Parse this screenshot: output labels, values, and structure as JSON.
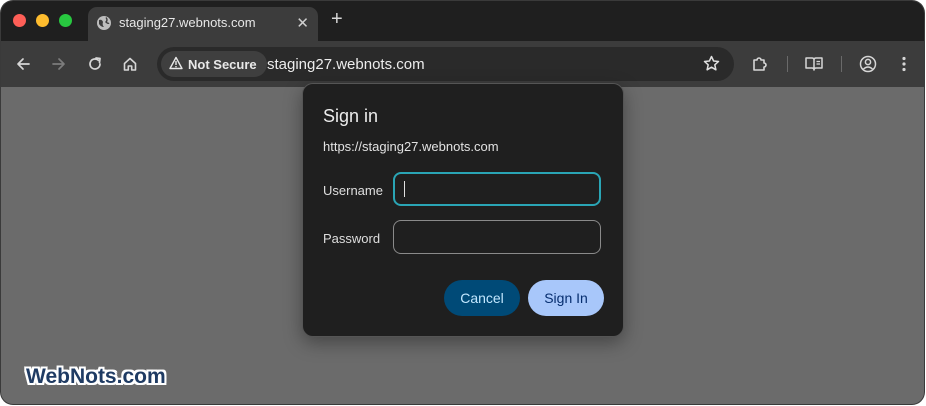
{
  "browser": {
    "tab": {
      "title": "staging27.webnots.com",
      "close_symbol": "✕"
    },
    "new_tab_symbol": "+",
    "omnibox": {
      "security_label": "Not Secure",
      "url": "staging27.webnots.com"
    }
  },
  "dialog": {
    "title": "Sign in",
    "origin": "https://staging27.webnots.com",
    "username_label": "Username",
    "username_value": "",
    "password_label": "Password",
    "password_value": "",
    "cancel_label": "Cancel",
    "signin_label": "Sign In"
  },
  "watermark": "WebNots.com",
  "colors": {
    "focus_ring": "#2aa5b5",
    "cancel_bg": "#004a77",
    "signin_bg": "#a8c7fa",
    "page_bg": "#6b6b6b"
  },
  "icons": [
    "globe-icon",
    "close-icon",
    "plus-icon",
    "back-icon",
    "forward-icon",
    "reload-icon",
    "home-icon",
    "warning-icon",
    "star-icon",
    "extensions-icon",
    "reading-mode-icon",
    "profile-icon",
    "menu-icon"
  ]
}
